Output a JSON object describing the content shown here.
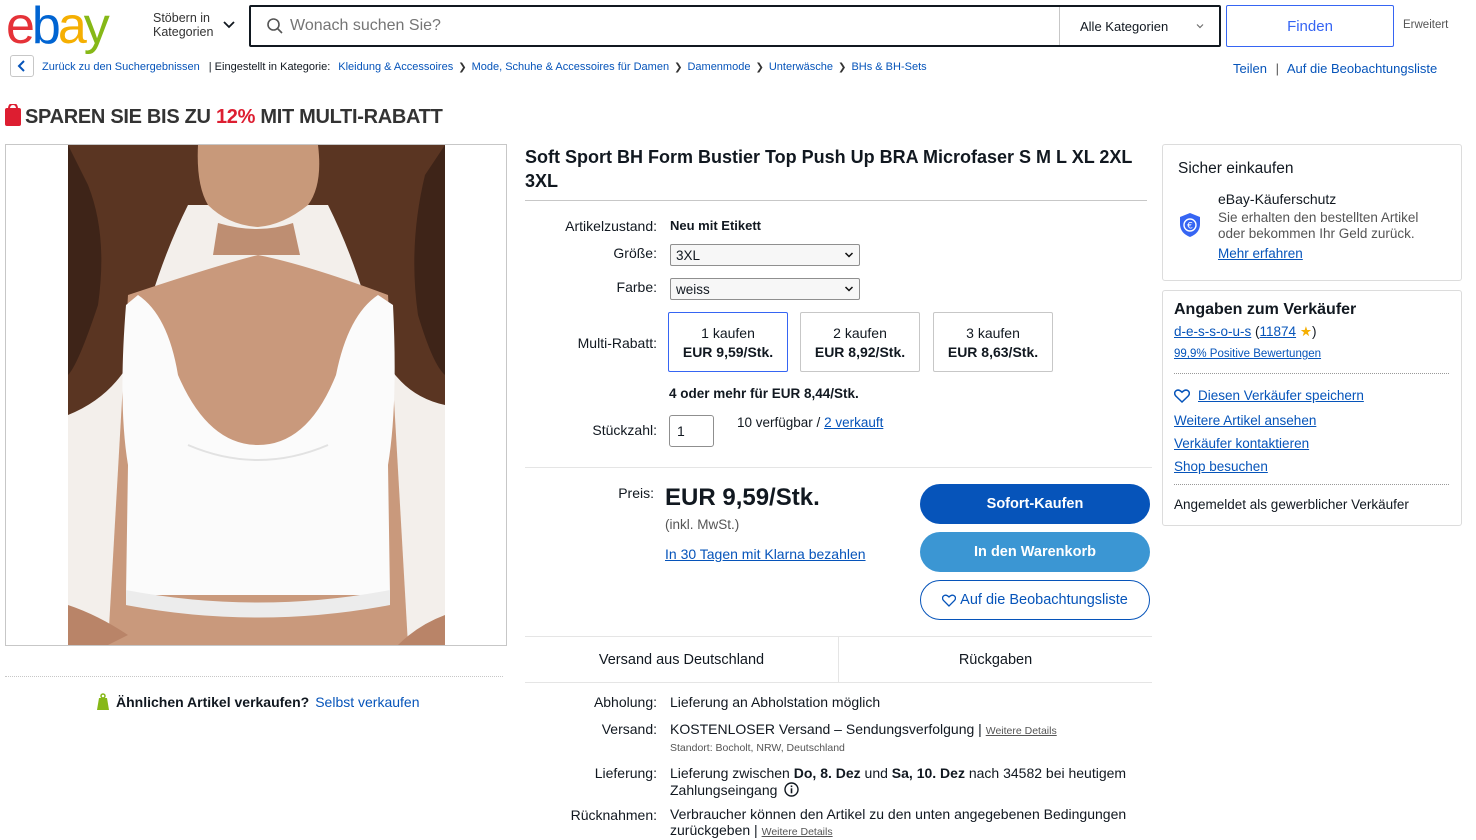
{
  "header": {
    "logo": "ebay",
    "browse_label_1": "Stöbern in",
    "browse_label_2": "Kategorien",
    "search_placeholder": "Wonach suchen Sie?",
    "category_select": "Alle Kategorien",
    "find_button": "Finden",
    "advanced_link": "Erweitert"
  },
  "breadcrumb": {
    "back": "Zurück zu den Suchergebnissen",
    "listed_in": "| Eingestellt in Kategorie:",
    "items": [
      "Kleidung & Accessoires",
      "Mode, Schuhe & Accessoires für Damen",
      "Damenmode",
      "Unterwäsche",
      "BHs & BH-Sets"
    ],
    "share": "Teilen",
    "watchlist": "Auf die Beobachtungsliste"
  },
  "promo": {
    "prefix": "SPAREN SIE BIS ZU ",
    "percent": "12%",
    "suffix": " MIT MULTI-RABATT"
  },
  "sell_similar": {
    "question": "Ähnlichen Artikel verkaufen?",
    "link": "Selbst verkaufen"
  },
  "item": {
    "title": "Soft Sport BH Form Bustier Top Push Up BRA Microfaser S M L XL 2XL 3XL",
    "condition_label": "Artikelzustand:",
    "condition_value": "Neu mit Etikett",
    "size_label": "Größe:",
    "size_value": "3XL",
    "color_label": "Farbe:",
    "color_value": "weiss",
    "multi_label": "Multi-Rabatt:",
    "tiers": [
      {
        "qty": "1 kaufen",
        "price": "EUR 9,59/Stk."
      },
      {
        "qty": "2 kaufen",
        "price": "EUR 8,92/Stk."
      },
      {
        "qty": "3 kaufen",
        "price": "EUR 8,63/Stk."
      }
    ],
    "tier_more": "4 oder mehr für EUR 8,44/Stk.",
    "qty_label": "Stückzahl:",
    "qty_value": "1",
    "available": "10 verfügbar / ",
    "sold": "2 verkauft",
    "price_label": "Preis:",
    "price": "EUR 9,59/Stk.",
    "vat": "(inkl. MwSt.)",
    "klarna": "In 30 Tagen mit Klarna bezahlen",
    "buy_now": "Sofort-Kaufen",
    "add_cart": "In den Warenkorb",
    "watch": "Auf die Beobachtungsliste"
  },
  "tabs": [
    "Versand aus Deutschland",
    "Rückgaben"
  ],
  "shipping": {
    "pickup_label": "Abholung:",
    "pickup_value": "Lieferung an Abholstation möglich",
    "ship_label": "Versand:",
    "ship_value": "KOSTENLOSER Versand – Sendungsverfolgung |",
    "ship_details": "Weitere Details",
    "location": "Standort: Bocholt, NRW, Deutschland",
    "delivery_label": "Lieferung:",
    "delivery_pre": "Lieferung zwischen ",
    "delivery_from": "Do, 8. Dez",
    "delivery_mid": " und ",
    "delivery_to": "Sa, 10. Dez",
    "delivery_post": " nach 34582 bei heutigem",
    "delivery_line2": "Zahlungseingang",
    "returns_label": "Rücknahmen:",
    "returns_value": "Verbraucher können den Artikel zu den unten angegebenen Bedingungen",
    "returns_line2": "zurückgeben |",
    "returns_details": "Weitere Details"
  },
  "protection": {
    "title": "Sicher einkaufen",
    "heading": "eBay-Käuferschutz",
    "text1": "Sie erhalten den bestellten Artikel",
    "text2": "oder bekommen Ihr Geld zurück.",
    "link": "Mehr erfahren"
  },
  "seller": {
    "title": "Angaben zum Verkäufer",
    "name": "d-e-s-s-o-u-s",
    "score": "11874",
    "positive": "99,9% Positive Bewertungen",
    "save": "Diesen Verkäufer speichern",
    "links": [
      "Weitere Artikel ansehen",
      "Verkäufer kontaktieren",
      "Shop besuchen"
    ],
    "type": "Angemeldet als gewerblicher Verkäufer"
  },
  "colors": {
    "ebay_red": "#e53238",
    "ebay_blue": "#0064d2",
    "ebay_yellow": "#f5af02",
    "ebay_green": "#86b817",
    "link_blue": "#0654ba",
    "promo_red": "#dd1e31"
  }
}
